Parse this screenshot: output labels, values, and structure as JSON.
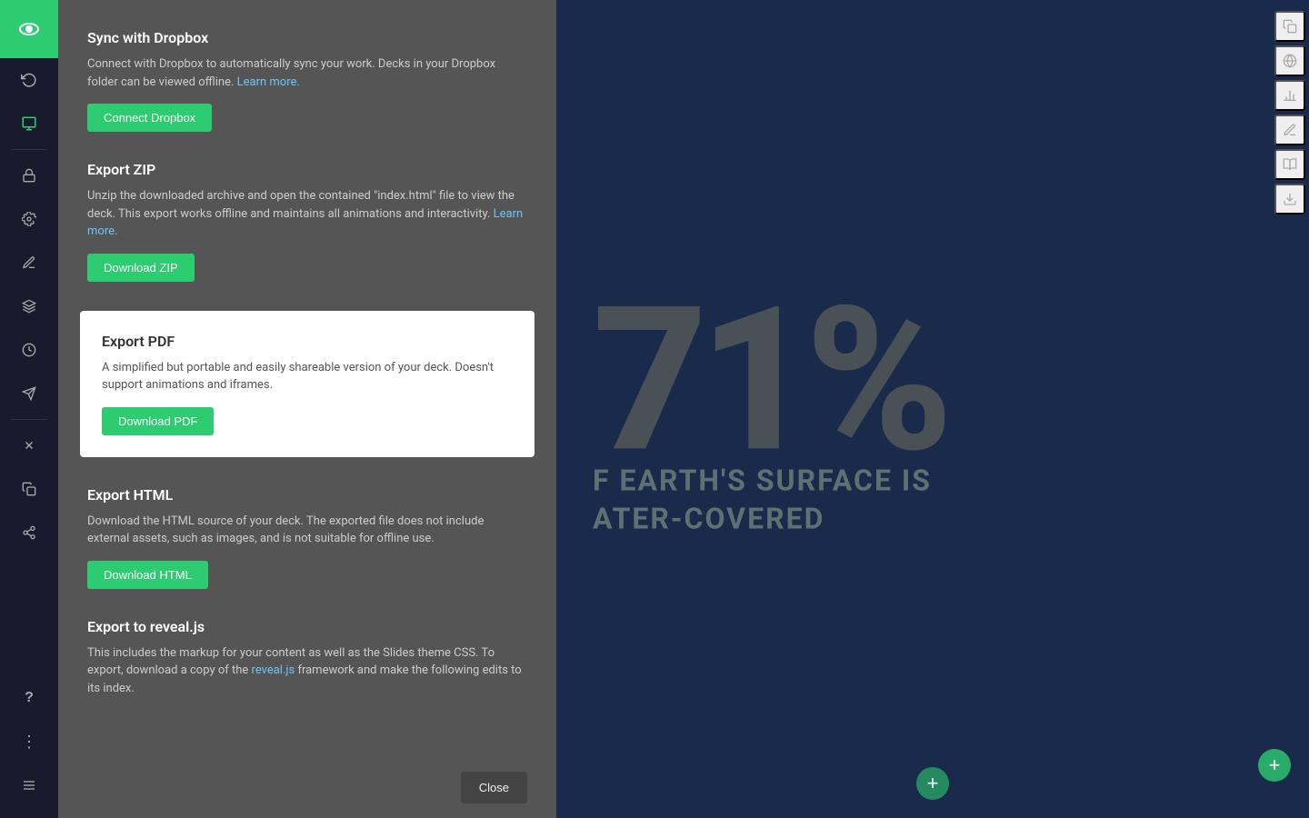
{
  "sidebar": {
    "logo_icon": "eye",
    "items": [
      {
        "name": "undo",
        "icon": "↩",
        "label": "undo-button",
        "active": false
      },
      {
        "name": "slide-view",
        "icon": "▣",
        "label": "slide-view-button",
        "active": true
      },
      {
        "name": "lock",
        "icon": "🔒",
        "label": "lock-button",
        "active": false
      },
      {
        "name": "settings",
        "icon": "⚙",
        "label": "settings-button",
        "active": false
      },
      {
        "name": "pencil",
        "icon": "✏",
        "label": "pencil-button",
        "active": false
      },
      {
        "name": "layers",
        "icon": "⊞",
        "label": "layers-button",
        "active": false
      },
      {
        "name": "clock",
        "icon": "🕐",
        "label": "clock-button",
        "active": false
      },
      {
        "name": "megaphone",
        "icon": "📢",
        "label": "megaphone-button",
        "active": false
      },
      {
        "name": "close",
        "icon": "✕",
        "label": "close-button",
        "active": false
      },
      {
        "name": "copy",
        "icon": "⧉",
        "label": "copy-button",
        "active": false
      },
      {
        "name": "share",
        "icon": "⎋",
        "label": "share-button",
        "active": false
      }
    ],
    "bottom_items": [
      {
        "name": "help",
        "icon": "?",
        "label": "help-button"
      },
      {
        "name": "more",
        "icon": "⋮",
        "label": "more-button"
      },
      {
        "name": "menu",
        "icon": "☰",
        "label": "menu-button"
      }
    ]
  },
  "export_panel": {
    "sections": [
      {
        "id": "dropbox",
        "title": "Sync with Dropbox",
        "description": "Connect with Dropbox to automatically sync your work. Decks in your Dropbox folder can be viewed offline.",
        "learn_more_text": "Learn more.",
        "button_label": "Connect Dropbox",
        "highlighted": false
      },
      {
        "id": "zip",
        "title": "Export ZIP",
        "description": "Unzip the downloaded archive and open the contained \"index.html\" file to view the deck. This export works offline and maintains all animations and interactivity.",
        "learn_more_text": "Learn more.",
        "button_label": "Download ZIP",
        "highlighted": false
      },
      {
        "id": "pdf",
        "title": "Export PDF",
        "description": "A simplified but portable and easily shareable version of your deck. Doesn't support animations and iframes.",
        "button_label": "Download PDF",
        "highlighted": true
      },
      {
        "id": "html",
        "title": "Export HTML",
        "description": "Download the HTML source of your deck. The exported file does not include external assets, such as images, and is not suitable for offline use.",
        "button_label": "Download HTML",
        "highlighted": false
      },
      {
        "id": "revealjs",
        "title": "Export to reveal.js",
        "description_part1": "This includes the markup for your content as well as the Slides theme CSS. To export, download a copy of the ",
        "link_text": "reveal.js",
        "description_part2": " framework and make the following edits to its index.",
        "button_label": null,
        "highlighted": false
      }
    ],
    "close_button_label": "Close"
  },
  "slide": {
    "percent": "71%",
    "subtitle_line1": "F EARTH'S SURFACE IS",
    "subtitle_line2": "ATER-COVERED"
  },
  "right_sidebar": {
    "icons": [
      {
        "name": "copy-icon",
        "symbol": "⧉"
      },
      {
        "name": "globe-icon",
        "symbol": "◎"
      },
      {
        "name": "chart-icon",
        "symbol": "⊿"
      },
      {
        "name": "pencil-tool-icon",
        "symbol": "/"
      },
      {
        "name": "book-icon",
        "symbol": "⊟"
      },
      {
        "name": "export-icon",
        "symbol": "⊡"
      }
    ],
    "add_button_label": "+"
  }
}
